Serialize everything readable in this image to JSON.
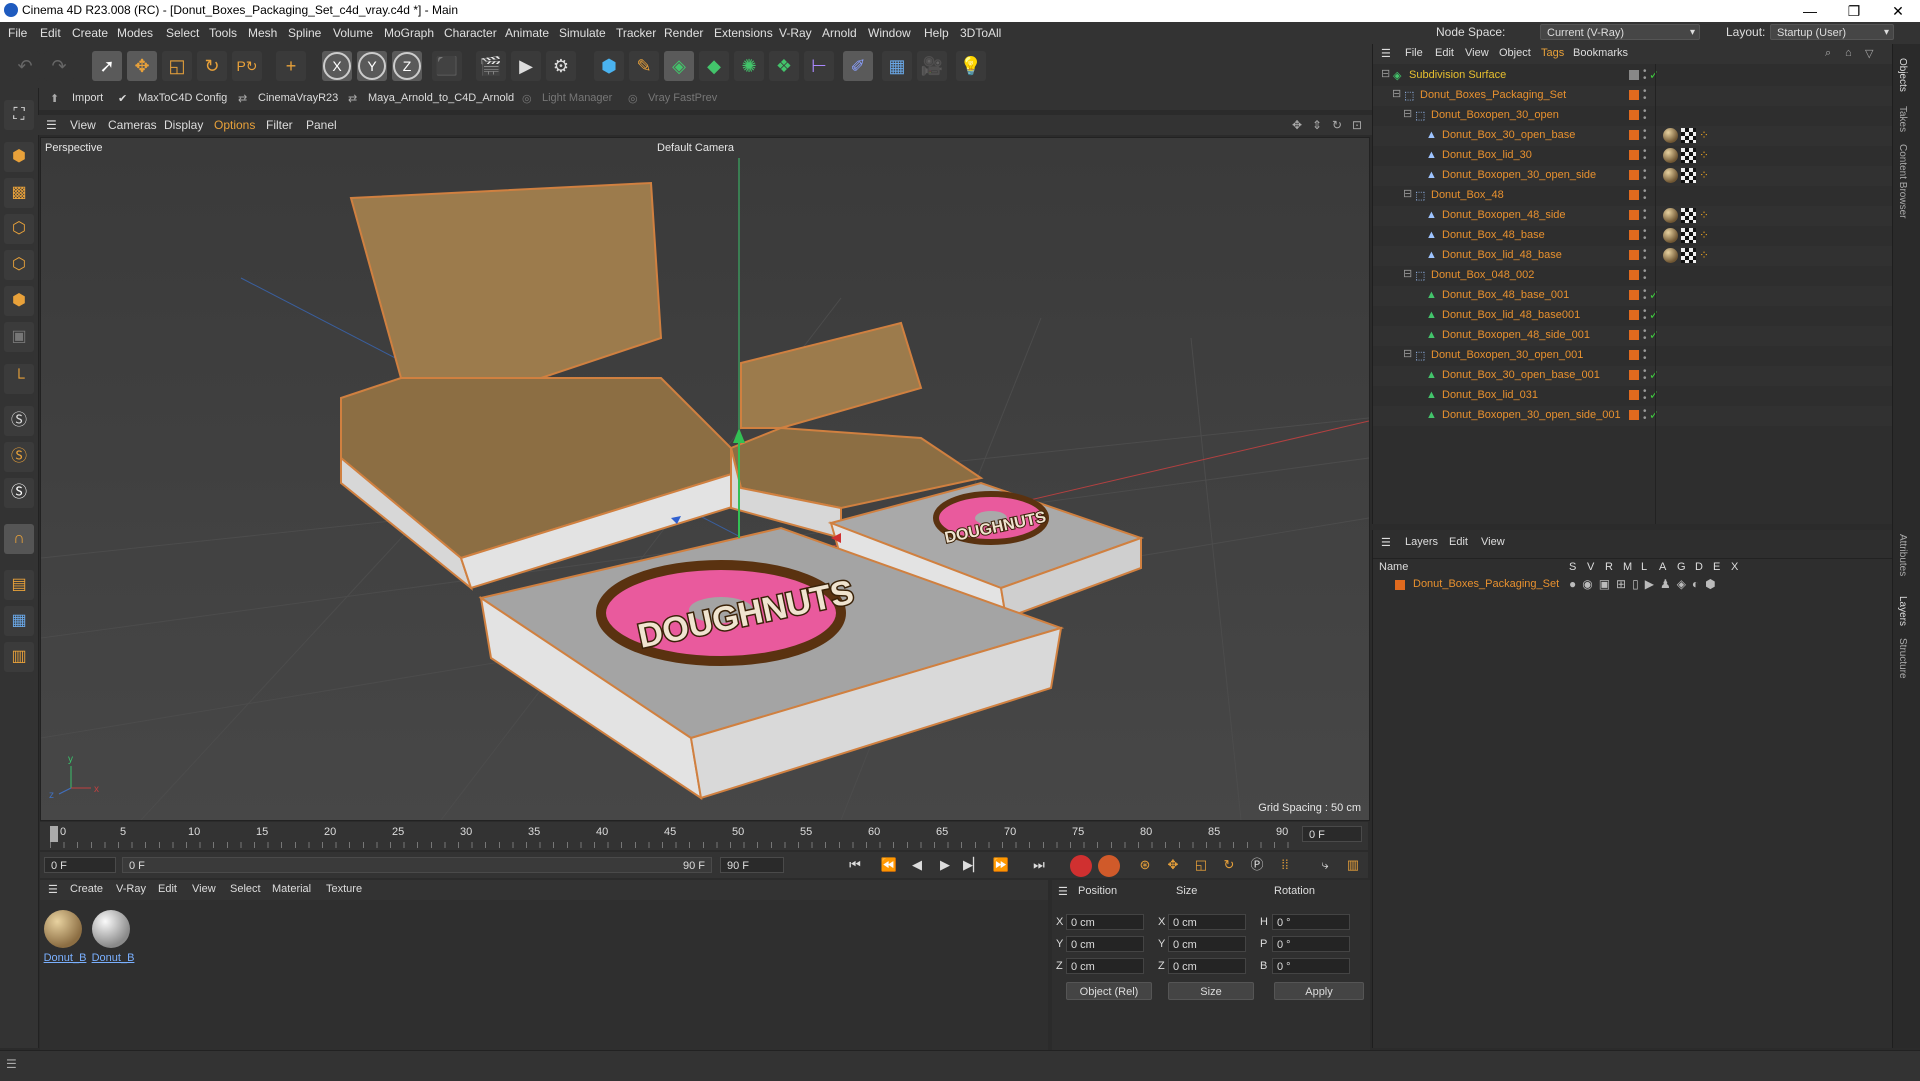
{
  "window": {
    "title": "Cinema 4D R23.008 (RC) - [Donut_Boxes_Packaging_Set_c4d_vray.c4d *] - Main",
    "controls": [
      "—",
      "❐",
      "✕"
    ]
  },
  "menubar": {
    "items": [
      "File",
      "Edit",
      "Create",
      "Modes",
      "Select",
      "Tools",
      "Mesh",
      "Spline",
      "Volume",
      "MoGraph",
      "Character",
      "Animate",
      "Simulate",
      "Tracker",
      "Render",
      "Extensions",
      "V-Ray",
      "Arnold",
      "Window",
      "Help",
      "3DToAll"
    ],
    "node_space_label": "Node Space:",
    "node_space_value": "Current (V-Ray)",
    "layout_label": "Layout:",
    "layout_value": "Startup (User)"
  },
  "toolbar": {
    "icons": [
      "undo-icon",
      "redo-icon",
      "select-icon",
      "move-icon",
      "scale-icon",
      "rotate-icon",
      "recent-icon",
      "add-icon",
      "x-axis-icon",
      "y-axis-icon",
      "z-axis-icon",
      "coordinate-icon",
      "render-region-icon",
      "render-view-icon",
      "render-settings-icon",
      "cube-icon",
      "pen-icon",
      "subdivision-icon",
      "array-icon",
      "cloner-icon",
      "deformer-icon",
      "field-icon",
      "camera-icon",
      "light-icon"
    ],
    "axis_labels": [
      "X",
      "Y",
      "Z"
    ]
  },
  "subtoolbar": {
    "items": [
      "Import",
      "MaxToC4D Config",
      "CinemaVrayR23",
      "Maya_Arnold_to_C4D_Arnold",
      "Light Manager",
      "Vray FastPrev"
    ]
  },
  "viewport": {
    "menu": [
      "View",
      "Cameras",
      "Display",
      "Options",
      "Filter",
      "Panel"
    ],
    "label": "Perspective",
    "camera": "Default Camera",
    "grid_spacing": "Grid Spacing : 50 cm",
    "logo_text": "DOUGHNUTS"
  },
  "timeline": {
    "ticks": [
      "0",
      "5",
      "10",
      "15",
      "20",
      "25",
      "30",
      "35",
      "40",
      "45",
      "50",
      "55",
      "60",
      "65",
      "70",
      "75",
      "80",
      "85",
      "90"
    ],
    "current_frame": "0 F",
    "start_frame": "0 F",
    "preview_start": "0 F",
    "preview_end": "90 F",
    "end_frame": "90 F"
  },
  "materials": {
    "menu": [
      "Create",
      "V-Ray",
      "Edit",
      "View",
      "Select",
      "Material",
      "Texture"
    ],
    "items": [
      {
        "name": "Donut_B",
        "color": "#a88a55"
      },
      {
        "name": "Donut_B",
        "color": "#cfcfcf"
      }
    ]
  },
  "attributes": {
    "headers": [
      "Position",
      "Size",
      "Rotation"
    ],
    "rows": [
      {
        "axis": "X",
        "pos": "0 cm",
        "size_axis": "X",
        "size": "0 cm",
        "rot_axis": "H",
        "rot": "0 °"
      },
      {
        "axis": "Y",
        "pos": "0 cm",
        "size_axis": "Y",
        "size": "0 cm",
        "rot_axis": "P",
        "rot": "0 °"
      },
      {
        "axis": "Z",
        "pos": "0 cm",
        "size_axis": "Z",
        "size": "0 cm",
        "rot_axis": "B",
        "rot": "0 °"
      }
    ],
    "coord_mode": "Object (Rel)",
    "size_mode": "Size",
    "apply": "Apply"
  },
  "objects": {
    "menu": [
      "File",
      "Edit",
      "View",
      "Object",
      "Tags",
      "Bookmarks"
    ],
    "tree": [
      {
        "name": "Subdivision Surface",
        "depth": 0,
        "color": "#e8c02f",
        "tags": "check"
      },
      {
        "name": "Donut_Boxes_Packaging_Set",
        "depth": 1,
        "tags": "none"
      },
      {
        "name": "Donut_Boxopen_30_open",
        "depth": 2,
        "tags": "none"
      },
      {
        "name": "Donut_Box_30_open_base",
        "depth": 3,
        "tags": "mat"
      },
      {
        "name": "Donut_Box_lid_30",
        "depth": 3,
        "tags": "mat"
      },
      {
        "name": "Donut_Boxopen_30_open_side",
        "depth": 3,
        "tags": "mat"
      },
      {
        "name": "Donut_Box_48",
        "depth": 2,
        "tags": "none"
      },
      {
        "name": "Donut_Boxopen_48_side",
        "depth": 3,
        "tags": "mat"
      },
      {
        "name": "Donut_Box_48_base",
        "depth": 3,
        "tags": "mat"
      },
      {
        "name": "Donut_Box_lid_48_base",
        "depth": 3,
        "tags": "mat"
      },
      {
        "name": "Donut_Box_048_002",
        "depth": 2,
        "tags": "none"
      },
      {
        "name": "Donut_Box_48_base_001",
        "depth": 3,
        "tags": "check"
      },
      {
        "name": "Donut_Box_lid_48_base001",
        "depth": 3,
        "tags": "check"
      },
      {
        "name": "Donut_Boxopen_48_side_001",
        "depth": 3,
        "tags": "check"
      },
      {
        "name": "Donut_Boxopen_30_open_001",
        "depth": 2,
        "tags": "none"
      },
      {
        "name": "Donut_Box_30_open_base_001",
        "depth": 3,
        "tags": "check"
      },
      {
        "name": "Donut_Box_lid_031",
        "depth": 3,
        "tags": "check"
      },
      {
        "name": "Donut_Boxopen_30_open_side_001",
        "depth": 3,
        "tags": "check"
      }
    ]
  },
  "layers": {
    "menu": [
      "Layers",
      "Edit",
      "View"
    ],
    "name_header": "Name",
    "columns": [
      "S",
      "V",
      "R",
      "M",
      "L",
      "A",
      "G",
      "D",
      "E",
      "X"
    ],
    "items": [
      {
        "name": "Donut_Boxes_Packaging_Set",
        "color": "#e06a1e"
      }
    ]
  },
  "side_tabs": [
    "Objects",
    "Takes",
    "Content Browser",
    "Attributes",
    "Layers",
    "Structure"
  ]
}
